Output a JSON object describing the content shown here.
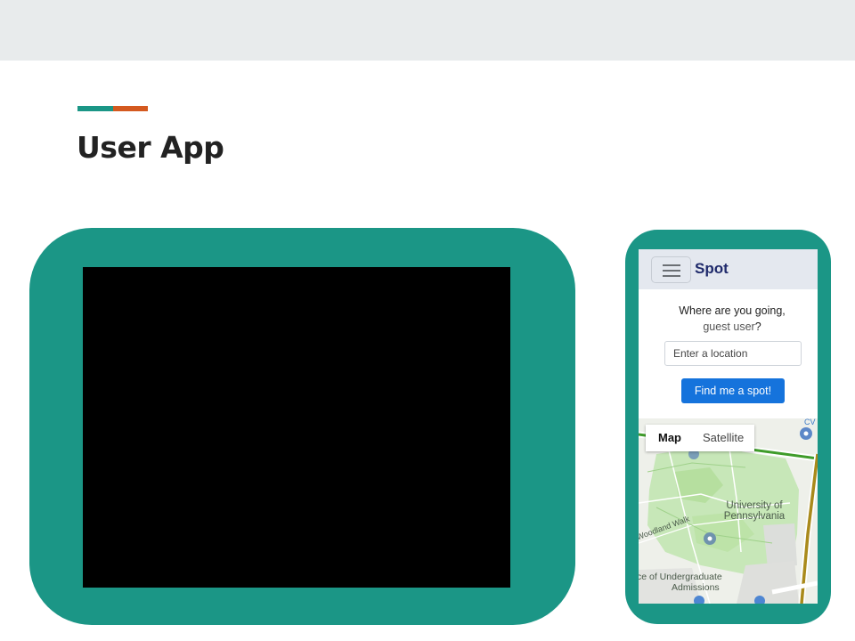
{
  "slide": {
    "title": "User App"
  },
  "colors": {
    "teal": "#1b9686",
    "orange": "#d4591f",
    "brand_navy": "#1f2a6b",
    "button_blue": "#1573dc"
  },
  "phone_app": {
    "brand": "Spot",
    "menu_icon": "hamburger-menu-icon",
    "prompt": "Where are you going,",
    "user_name": "guest user",
    "user_suffix": "?",
    "location_placeholder": "Enter a location",
    "find_button": "Find me a spot!",
    "map": {
      "toggle_map": "Map",
      "toggle_satellite": "Satellite",
      "label_university": "University of Pennsylvania",
      "label_university_line1": "University of",
      "label_university_line2": "Pennsylvania",
      "label_walk": "Woodland Walk",
      "label_admissions_line1": "ce of Undergraduate",
      "label_admissions_line2": "Admissions",
      "label_corner": "CV"
    }
  }
}
